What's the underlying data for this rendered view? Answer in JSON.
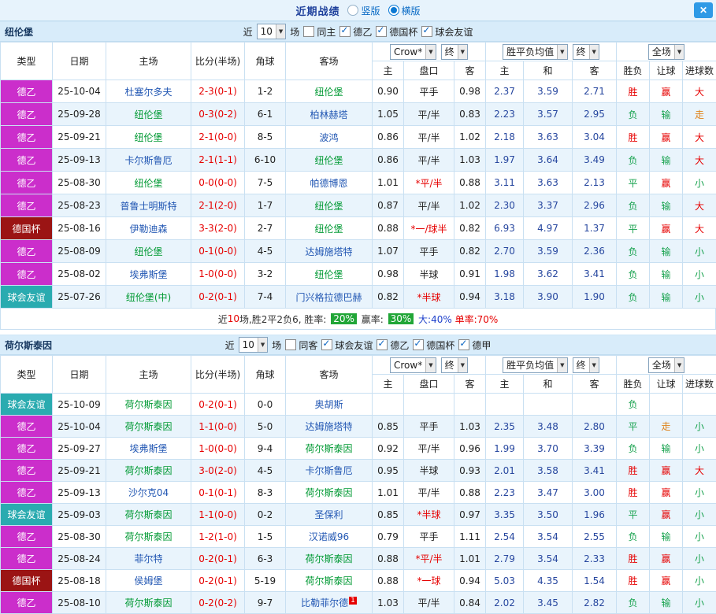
{
  "titlebar": {
    "title": "近期战绩",
    "radios": [
      {
        "label": "竖版",
        "selected": false
      },
      {
        "label": "横版",
        "selected": true
      }
    ],
    "close_label": "✕"
  },
  "table_header": {
    "type": "类型",
    "date": "日期",
    "home": "主场",
    "score": "比分(半场)",
    "corner": "角球",
    "away": "客场",
    "asian_select": "Crow*",
    "asian_final_select": "终",
    "europe_select": "胜平负均值",
    "europe_final_select": "终",
    "scope_select": "全场",
    "sub_home": "主",
    "sub_handicap": "盘口",
    "sub_away": "客",
    "sub_eu_home": "主",
    "sub_eu_draw": "和",
    "sub_eu_away": "客",
    "sub_wdl": "胜负",
    "sub_let": "让球",
    "sub_goals": "进球数"
  },
  "colors": {
    "league_dey2": "#cb2ecb",
    "league_cup": "#9b1414",
    "league_friendly": "#2aabb0",
    "team_link": "#2257b3",
    "focus_team": "#009933",
    "score_red": "#e60000",
    "win_red": "#e60000",
    "lose_green": "#17a24e",
    "push_orange": "#e0821a",
    "rate_badge_green": "#21a637"
  },
  "sections": [
    {
      "team": "纽伦堡",
      "filter": {
        "near": "近",
        "count": "10",
        "unit": "场",
        "checkboxes": [
          {
            "label": "同主",
            "checked": false
          },
          {
            "label": "德乙",
            "checked": true
          },
          {
            "label": "德国杯",
            "checked": true
          },
          {
            "label": "球会友谊",
            "checked": true
          }
        ]
      },
      "rows": [
        {
          "league": "德乙",
          "league_color": "dey2",
          "date": "25-10-04",
          "home": "杜塞尔多夫",
          "home_focus": false,
          "score": "2-3(0-1)",
          "corner": "1-2",
          "away": "纽伦堡",
          "away_focus": true,
          "away_badge": "",
          "odds_home": "0.90",
          "handicap": "平手",
          "odds_away": "0.98",
          "avg_home": "2.37",
          "avg_draw": "3.59",
          "avg_away": "2.71",
          "res_wdl": "胜",
          "res_handicap": "赢",
          "res_goals": "大"
        },
        {
          "league": "德乙",
          "league_color": "dey2",
          "date": "25-09-28",
          "home": "纽伦堡",
          "home_focus": true,
          "score": "0-3(0-2)",
          "corner": "6-1",
          "away": "柏林赫塔",
          "away_focus": false,
          "away_badge": "",
          "odds_home": "1.05",
          "handicap": "平/半",
          "odds_away": "0.83",
          "avg_home": "2.23",
          "avg_draw": "3.57",
          "avg_away": "2.95",
          "res_wdl": "负",
          "res_handicap": "输",
          "res_goals": "走"
        },
        {
          "league": "德乙",
          "league_color": "dey2",
          "date": "25-09-21",
          "home": "纽伦堡",
          "home_focus": true,
          "score": "2-1(0-0)",
          "corner": "8-5",
          "away": "波鸿",
          "away_focus": false,
          "away_badge": "",
          "odds_home": "0.86",
          "handicap": "平/半",
          "odds_away": "1.02",
          "avg_home": "2.18",
          "avg_draw": "3.63",
          "avg_away": "3.04",
          "res_wdl": "胜",
          "res_handicap": "赢",
          "res_goals": "大"
        },
        {
          "league": "德乙",
          "league_color": "dey2",
          "date": "25-09-13",
          "home": "卡尔斯鲁厄",
          "home_focus": false,
          "score": "2-1(1-1)",
          "corner": "6-10",
          "away": "纽伦堡",
          "away_focus": true,
          "away_badge": "",
          "odds_home": "0.86",
          "handicap": "平/半",
          "odds_away": "1.03",
          "avg_home": "1.97",
          "avg_draw": "3.64",
          "avg_away": "3.49",
          "res_wdl": "负",
          "res_handicap": "输",
          "res_goals": "大"
        },
        {
          "league": "德乙",
          "league_color": "dey2",
          "date": "25-08-30",
          "home": "纽伦堡",
          "home_focus": true,
          "score": "0-0(0-0)",
          "corner": "7-5",
          "away": "帕德博恩",
          "away_focus": false,
          "away_badge": "",
          "odds_home": "1.01",
          "handicap": "*平/半",
          "odds_away": "0.88",
          "avg_home": "3.11",
          "avg_draw": "3.63",
          "avg_away": "2.13",
          "res_wdl": "平",
          "res_handicap": "赢",
          "res_goals": "小"
        },
        {
          "league": "德乙",
          "league_color": "dey2",
          "date": "25-08-23",
          "home": "普鲁士明斯特",
          "home_focus": false,
          "score": "2-1(2-0)",
          "corner": "1-7",
          "away": "纽伦堡",
          "away_focus": true,
          "away_badge": "",
          "odds_home": "0.87",
          "handicap": "平/半",
          "odds_away": "1.02",
          "avg_home": "2.30",
          "avg_draw": "3.37",
          "avg_away": "2.96",
          "res_wdl": "负",
          "res_handicap": "输",
          "res_goals": "大"
        },
        {
          "league": "德国杯",
          "league_color": "cup",
          "date": "25-08-16",
          "home": "伊勒迪森",
          "home_focus": false,
          "score": "3-3(2-0)",
          "corner": "2-7",
          "away": "纽伦堡",
          "away_focus": true,
          "away_badge": "",
          "odds_home": "0.88",
          "handicap": "*一/球半",
          "odds_away": "0.82",
          "avg_home": "6.93",
          "avg_draw": "4.97",
          "avg_away": "1.37",
          "res_wdl": "平",
          "res_handicap": "赢",
          "res_goals": "大"
        },
        {
          "league": "德乙",
          "league_color": "dey2",
          "date": "25-08-09",
          "home": "纽伦堡",
          "home_focus": true,
          "score": "0-1(0-0)",
          "corner": "4-5",
          "away": "达姆施塔特",
          "away_focus": false,
          "away_badge": "",
          "odds_home": "1.07",
          "handicap": "平手",
          "odds_away": "0.82",
          "avg_home": "2.70",
          "avg_draw": "3.59",
          "avg_away": "2.36",
          "res_wdl": "负",
          "res_handicap": "输",
          "res_goals": "小"
        },
        {
          "league": "德乙",
          "league_color": "dey2",
          "date": "25-08-02",
          "home": "埃弗斯堡",
          "home_focus": false,
          "score": "1-0(0-0)",
          "corner": "3-2",
          "away": "纽伦堡",
          "away_focus": true,
          "away_badge": "",
          "odds_home": "0.98",
          "handicap": "半球",
          "odds_away": "0.91",
          "avg_home": "1.98",
          "avg_draw": "3.62",
          "avg_away": "3.41",
          "res_wdl": "负",
          "res_handicap": "输",
          "res_goals": "小"
        },
        {
          "league": "球会友谊",
          "league_color": "friendly",
          "date": "25-07-26",
          "home": "纽伦堡(中)",
          "home_focus": true,
          "score": "0-2(0-1)",
          "corner": "7-4",
          "away": "门兴格拉德巴赫",
          "away_focus": false,
          "away_badge": "",
          "odds_home": "0.82",
          "handicap": "*半球",
          "odds_away": "0.94",
          "avg_home": "3.18",
          "avg_draw": "3.90",
          "avg_away": "1.90",
          "res_wdl": "负",
          "res_handicap": "输",
          "res_goals": "小"
        }
      ],
      "summary": [
        {
          "text": "近",
          "style": "plain"
        },
        {
          "text": "10",
          "style": "red"
        },
        {
          "text": "场,胜2平2负6, 胜率: ",
          "style": "plain"
        },
        {
          "text": "20%",
          "style": "badge"
        },
        {
          "text": " 赢率: ",
          "style": "plain"
        },
        {
          "text": "30%",
          "style": "badge"
        },
        {
          "text": " 大:40%",
          "style": "blue"
        },
        {
          "text": " 单率:70%",
          "style": "red"
        }
      ]
    },
    {
      "team": "荷尔斯泰因",
      "filter": {
        "near": "近",
        "count": "10",
        "unit": "场",
        "checkboxes": [
          {
            "label": "同客",
            "checked": false
          },
          {
            "label": "球会友谊",
            "checked": true
          },
          {
            "label": "德乙",
            "checked": true
          },
          {
            "label": "德国杯",
            "checked": true
          },
          {
            "label": "德甲",
            "checked": true
          }
        ]
      },
      "rows": [
        {
          "league": "球会友谊",
          "league_color": "friendly",
          "date": "25-10-09",
          "home": "荷尔斯泰因",
          "home_focus": true,
          "score": "0-2(0-1)",
          "corner": "0-0",
          "away": "奥胡斯",
          "away_focus": false,
          "away_badge": "",
          "odds_home": "",
          "handicap": "",
          "odds_away": "",
          "avg_home": "",
          "avg_draw": "",
          "avg_away": "",
          "res_wdl": "负",
          "res_handicap": "",
          "res_goals": ""
        },
        {
          "league": "德乙",
          "league_color": "dey2",
          "date": "25-10-04",
          "home": "荷尔斯泰因",
          "home_focus": true,
          "score": "1-1(0-0)",
          "corner": "5-0",
          "away": "达姆施塔特",
          "away_focus": false,
          "away_badge": "",
          "odds_home": "0.85",
          "handicap": "平手",
          "odds_away": "1.03",
          "avg_home": "2.35",
          "avg_draw": "3.48",
          "avg_away": "2.80",
          "res_wdl": "平",
          "res_handicap": "走",
          "res_goals": "小"
        },
        {
          "league": "德乙",
          "league_color": "dey2",
          "date": "25-09-27",
          "home": "埃弗斯堡",
          "home_focus": false,
          "score": "1-0(0-0)",
          "corner": "9-4",
          "away": "荷尔斯泰因",
          "away_focus": true,
          "away_badge": "",
          "odds_home": "0.92",
          "handicap": "平/半",
          "odds_away": "0.96",
          "avg_home": "1.99",
          "avg_draw": "3.70",
          "avg_away": "3.39",
          "res_wdl": "负",
          "res_handicap": "输",
          "res_goals": "小"
        },
        {
          "league": "德乙",
          "league_color": "dey2",
          "date": "25-09-21",
          "home": "荷尔斯泰因",
          "home_focus": true,
          "score": "3-0(2-0)",
          "corner": "4-5",
          "away": "卡尔斯鲁厄",
          "away_focus": false,
          "away_badge": "",
          "odds_home": "0.95",
          "handicap": "半球",
          "odds_away": "0.93",
          "avg_home": "2.01",
          "avg_draw": "3.58",
          "avg_away": "3.41",
          "res_wdl": "胜",
          "res_handicap": "赢",
          "res_goals": "大"
        },
        {
          "league": "德乙",
          "league_color": "dey2",
          "date": "25-09-13",
          "home": "沙尔克04",
          "home_focus": false,
          "score": "0-1(0-1)",
          "corner": "8-3",
          "away": "荷尔斯泰因",
          "away_focus": true,
          "away_badge": "",
          "odds_home": "1.01",
          "handicap": "平/半",
          "odds_away": "0.88",
          "avg_home": "2.23",
          "avg_draw": "3.47",
          "avg_away": "3.00",
          "res_wdl": "胜",
          "res_handicap": "赢",
          "res_goals": "小"
        },
        {
          "league": "球会友谊",
          "league_color": "friendly",
          "date": "25-09-03",
          "home": "荷尔斯泰因",
          "home_focus": true,
          "score": "1-1(0-0)",
          "corner": "0-2",
          "away": "圣保利",
          "away_focus": false,
          "away_badge": "",
          "odds_home": "0.85",
          "handicap": "*半球",
          "odds_away": "0.97",
          "avg_home": "3.35",
          "avg_draw": "3.50",
          "avg_away": "1.96",
          "res_wdl": "平",
          "res_handicap": "赢",
          "res_goals": "小"
        },
        {
          "league": "德乙",
          "league_color": "dey2",
          "date": "25-08-30",
          "home": "荷尔斯泰因",
          "home_focus": true,
          "score": "1-2(1-0)",
          "corner": "1-5",
          "away": "汉诺威96",
          "away_focus": false,
          "away_badge": "",
          "odds_home": "0.79",
          "handicap": "平手",
          "odds_away": "1.11",
          "avg_home": "2.54",
          "avg_draw": "3.54",
          "avg_away": "2.55",
          "res_wdl": "负",
          "res_handicap": "输",
          "res_goals": "小"
        },
        {
          "league": "德乙",
          "league_color": "dey2",
          "date": "25-08-24",
          "home": "菲尔特",
          "home_focus": false,
          "score": "0-2(0-1)",
          "corner": "6-3",
          "away": "荷尔斯泰因",
          "away_focus": true,
          "away_badge": "",
          "odds_home": "0.88",
          "handicap": "*平/半",
          "odds_away": "1.01",
          "avg_home": "2.79",
          "avg_draw": "3.54",
          "avg_away": "2.33",
          "res_wdl": "胜",
          "res_handicap": "赢",
          "res_goals": "小"
        },
        {
          "league": "德国杯",
          "league_color": "cup",
          "date": "25-08-18",
          "home": "侯姆堡",
          "home_focus": false,
          "score": "0-2(0-1)",
          "corner": "5-19",
          "away": "荷尔斯泰因",
          "away_focus": true,
          "away_badge": "",
          "odds_home": "0.88",
          "handicap": "*一球",
          "odds_away": "0.94",
          "avg_home": "5.03",
          "avg_draw": "4.35",
          "avg_away": "1.54",
          "res_wdl": "胜",
          "res_handicap": "赢",
          "res_goals": "小"
        },
        {
          "league": "德乙",
          "league_color": "dey2",
          "date": "25-08-10",
          "home": "荷尔斯泰因",
          "home_focus": true,
          "score": "0-2(0-2)",
          "corner": "9-7",
          "away": "比勒菲尔德",
          "away_focus": false,
          "away_badge": "1",
          "odds_home": "1.03",
          "handicap": "平/半",
          "odds_away": "0.84",
          "avg_home": "2.02",
          "avg_draw": "3.45",
          "avg_away": "2.82",
          "res_wdl": "负",
          "res_handicap": "输",
          "res_goals": "小"
        }
      ]
    }
  ]
}
